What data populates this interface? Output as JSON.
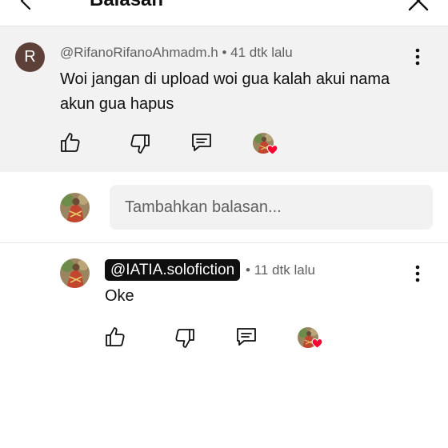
{
  "header": {
    "title": "Balasan",
    "back_icon": "arrow-back-icon",
    "close_icon": "close-icon"
  },
  "parent_comment": {
    "avatar_letter": "R",
    "avatar_color": "#5d4037",
    "author": "@RifanoRifanoAhmadm.h",
    "separator": " • ",
    "time": "41 dtk lalu",
    "text": "Woi jangan di upload woi gua kalah akui nama akun gua hapus",
    "actions": [
      "like-icon",
      "dislike-icon",
      "reply-icon",
      "creator-heart"
    ]
  },
  "reply_box": {
    "placeholder": "Tambahkan balasan..."
  },
  "reply_comment": {
    "author": "@IATIA.solofiction",
    "separator": "• ",
    "time": "11 dtk lalu",
    "text": "Oke",
    "actions": [
      "like-icon",
      "dislike-icon",
      "reply-icon",
      "creator-heart"
    ]
  },
  "colors": {
    "heart": "#ff0033",
    "panel": "#f2f2f2",
    "secondary_text": "#606060"
  }
}
